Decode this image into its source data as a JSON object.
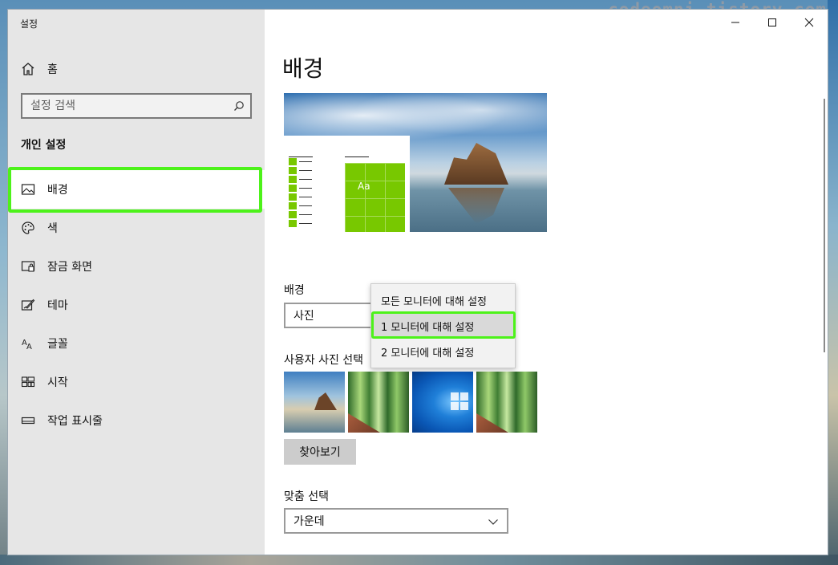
{
  "watermark": "codeomni.tistory.com",
  "window": {
    "title": "설정"
  },
  "sidebar": {
    "home_label": "홈",
    "search_placeholder": "설정 검색",
    "section_title": "개인 설정",
    "items": [
      {
        "label": "배경",
        "icon": "picture-icon",
        "selected": true
      },
      {
        "label": "색",
        "icon": "palette-icon",
        "selected": false
      },
      {
        "label": "잠금 화면",
        "icon": "lock-screen-icon",
        "selected": false
      },
      {
        "label": "테마",
        "icon": "theme-brush-icon",
        "selected": false
      },
      {
        "label": "글꼴",
        "icon": "font-icon",
        "selected": false
      },
      {
        "label": "시작",
        "icon": "start-tiles-icon",
        "selected": false
      },
      {
        "label": "작업 표시줄",
        "icon": "taskbar-icon",
        "selected": false
      }
    ]
  },
  "main": {
    "title": "배경",
    "preview": {
      "sample_text": "Aa"
    },
    "background_label": "배경",
    "background_value": "사진",
    "context_menu": {
      "options": [
        "모든 모니터에 대해 설정",
        "1 모니터에 대해 설정",
        "2 모니터에 대해 설정"
      ],
      "hovered_index": 1
    },
    "choose_photo_label": "사용자 사진 선택",
    "thumbnails": [
      "beach-rock-photo",
      "bamboo-photo",
      "windows-10-photo",
      "bamboo-photo"
    ],
    "browse_button": "찾아보기",
    "fit_label": "맞춤 선택",
    "fit_value": "가운데"
  },
  "colors": {
    "highlight": "#4df21a",
    "sidebar_bg": "#e6e6e6",
    "accent_tile": "#78c800"
  }
}
